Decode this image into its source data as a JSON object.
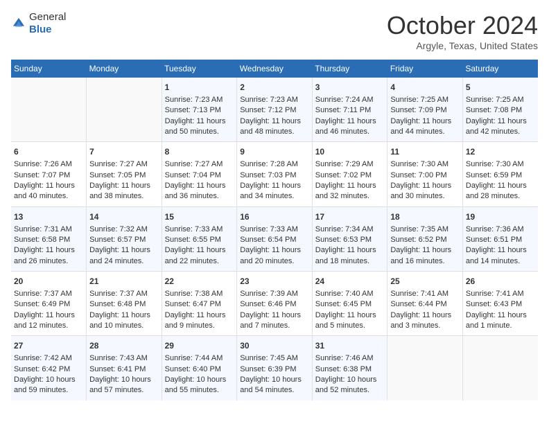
{
  "header": {
    "logo_general": "General",
    "logo_blue": "Blue",
    "title": "October 2024",
    "location": "Argyle, Texas, United States"
  },
  "weekdays": [
    "Sunday",
    "Monday",
    "Tuesday",
    "Wednesday",
    "Thursday",
    "Friday",
    "Saturday"
  ],
  "weeks": [
    [
      {
        "day": "",
        "sunrise": "",
        "sunset": "",
        "daylight": ""
      },
      {
        "day": "",
        "sunrise": "",
        "sunset": "",
        "daylight": ""
      },
      {
        "day": "1",
        "sunrise": "Sunrise: 7:23 AM",
        "sunset": "Sunset: 7:13 PM",
        "daylight": "Daylight: 11 hours and 50 minutes."
      },
      {
        "day": "2",
        "sunrise": "Sunrise: 7:23 AM",
        "sunset": "Sunset: 7:12 PM",
        "daylight": "Daylight: 11 hours and 48 minutes."
      },
      {
        "day": "3",
        "sunrise": "Sunrise: 7:24 AM",
        "sunset": "Sunset: 7:11 PM",
        "daylight": "Daylight: 11 hours and 46 minutes."
      },
      {
        "day": "4",
        "sunrise": "Sunrise: 7:25 AM",
        "sunset": "Sunset: 7:09 PM",
        "daylight": "Daylight: 11 hours and 44 minutes."
      },
      {
        "day": "5",
        "sunrise": "Sunrise: 7:25 AM",
        "sunset": "Sunset: 7:08 PM",
        "daylight": "Daylight: 11 hours and 42 minutes."
      }
    ],
    [
      {
        "day": "6",
        "sunrise": "Sunrise: 7:26 AM",
        "sunset": "Sunset: 7:07 PM",
        "daylight": "Daylight: 11 hours and 40 minutes."
      },
      {
        "day": "7",
        "sunrise": "Sunrise: 7:27 AM",
        "sunset": "Sunset: 7:05 PM",
        "daylight": "Daylight: 11 hours and 38 minutes."
      },
      {
        "day": "8",
        "sunrise": "Sunrise: 7:27 AM",
        "sunset": "Sunset: 7:04 PM",
        "daylight": "Daylight: 11 hours and 36 minutes."
      },
      {
        "day": "9",
        "sunrise": "Sunrise: 7:28 AM",
        "sunset": "Sunset: 7:03 PM",
        "daylight": "Daylight: 11 hours and 34 minutes."
      },
      {
        "day": "10",
        "sunrise": "Sunrise: 7:29 AM",
        "sunset": "Sunset: 7:02 PM",
        "daylight": "Daylight: 11 hours and 32 minutes."
      },
      {
        "day": "11",
        "sunrise": "Sunrise: 7:30 AM",
        "sunset": "Sunset: 7:00 PM",
        "daylight": "Daylight: 11 hours and 30 minutes."
      },
      {
        "day": "12",
        "sunrise": "Sunrise: 7:30 AM",
        "sunset": "Sunset: 6:59 PM",
        "daylight": "Daylight: 11 hours and 28 minutes."
      }
    ],
    [
      {
        "day": "13",
        "sunrise": "Sunrise: 7:31 AM",
        "sunset": "Sunset: 6:58 PM",
        "daylight": "Daylight: 11 hours and 26 minutes."
      },
      {
        "day": "14",
        "sunrise": "Sunrise: 7:32 AM",
        "sunset": "Sunset: 6:57 PM",
        "daylight": "Daylight: 11 hours and 24 minutes."
      },
      {
        "day": "15",
        "sunrise": "Sunrise: 7:33 AM",
        "sunset": "Sunset: 6:55 PM",
        "daylight": "Daylight: 11 hours and 22 minutes."
      },
      {
        "day": "16",
        "sunrise": "Sunrise: 7:33 AM",
        "sunset": "Sunset: 6:54 PM",
        "daylight": "Daylight: 11 hours and 20 minutes."
      },
      {
        "day": "17",
        "sunrise": "Sunrise: 7:34 AM",
        "sunset": "Sunset: 6:53 PM",
        "daylight": "Daylight: 11 hours and 18 minutes."
      },
      {
        "day": "18",
        "sunrise": "Sunrise: 7:35 AM",
        "sunset": "Sunset: 6:52 PM",
        "daylight": "Daylight: 11 hours and 16 minutes."
      },
      {
        "day": "19",
        "sunrise": "Sunrise: 7:36 AM",
        "sunset": "Sunset: 6:51 PM",
        "daylight": "Daylight: 11 hours and 14 minutes."
      }
    ],
    [
      {
        "day": "20",
        "sunrise": "Sunrise: 7:37 AM",
        "sunset": "Sunset: 6:49 PM",
        "daylight": "Daylight: 11 hours and 12 minutes."
      },
      {
        "day": "21",
        "sunrise": "Sunrise: 7:37 AM",
        "sunset": "Sunset: 6:48 PM",
        "daylight": "Daylight: 11 hours and 10 minutes."
      },
      {
        "day": "22",
        "sunrise": "Sunrise: 7:38 AM",
        "sunset": "Sunset: 6:47 PM",
        "daylight": "Daylight: 11 hours and 9 minutes."
      },
      {
        "day": "23",
        "sunrise": "Sunrise: 7:39 AM",
        "sunset": "Sunset: 6:46 PM",
        "daylight": "Daylight: 11 hours and 7 minutes."
      },
      {
        "day": "24",
        "sunrise": "Sunrise: 7:40 AM",
        "sunset": "Sunset: 6:45 PM",
        "daylight": "Daylight: 11 hours and 5 minutes."
      },
      {
        "day": "25",
        "sunrise": "Sunrise: 7:41 AM",
        "sunset": "Sunset: 6:44 PM",
        "daylight": "Daylight: 11 hours and 3 minutes."
      },
      {
        "day": "26",
        "sunrise": "Sunrise: 7:41 AM",
        "sunset": "Sunset: 6:43 PM",
        "daylight": "Daylight: 11 hours and 1 minute."
      }
    ],
    [
      {
        "day": "27",
        "sunrise": "Sunrise: 7:42 AM",
        "sunset": "Sunset: 6:42 PM",
        "daylight": "Daylight: 10 hours and 59 minutes."
      },
      {
        "day": "28",
        "sunrise": "Sunrise: 7:43 AM",
        "sunset": "Sunset: 6:41 PM",
        "daylight": "Daylight: 10 hours and 57 minutes."
      },
      {
        "day": "29",
        "sunrise": "Sunrise: 7:44 AM",
        "sunset": "Sunset: 6:40 PM",
        "daylight": "Daylight: 10 hours and 55 minutes."
      },
      {
        "day": "30",
        "sunrise": "Sunrise: 7:45 AM",
        "sunset": "Sunset: 6:39 PM",
        "daylight": "Daylight: 10 hours and 54 minutes."
      },
      {
        "day": "31",
        "sunrise": "Sunrise: 7:46 AM",
        "sunset": "Sunset: 6:38 PM",
        "daylight": "Daylight: 10 hours and 52 minutes."
      },
      {
        "day": "",
        "sunrise": "",
        "sunset": "",
        "daylight": ""
      },
      {
        "day": "",
        "sunrise": "",
        "sunset": "",
        "daylight": ""
      }
    ]
  ]
}
